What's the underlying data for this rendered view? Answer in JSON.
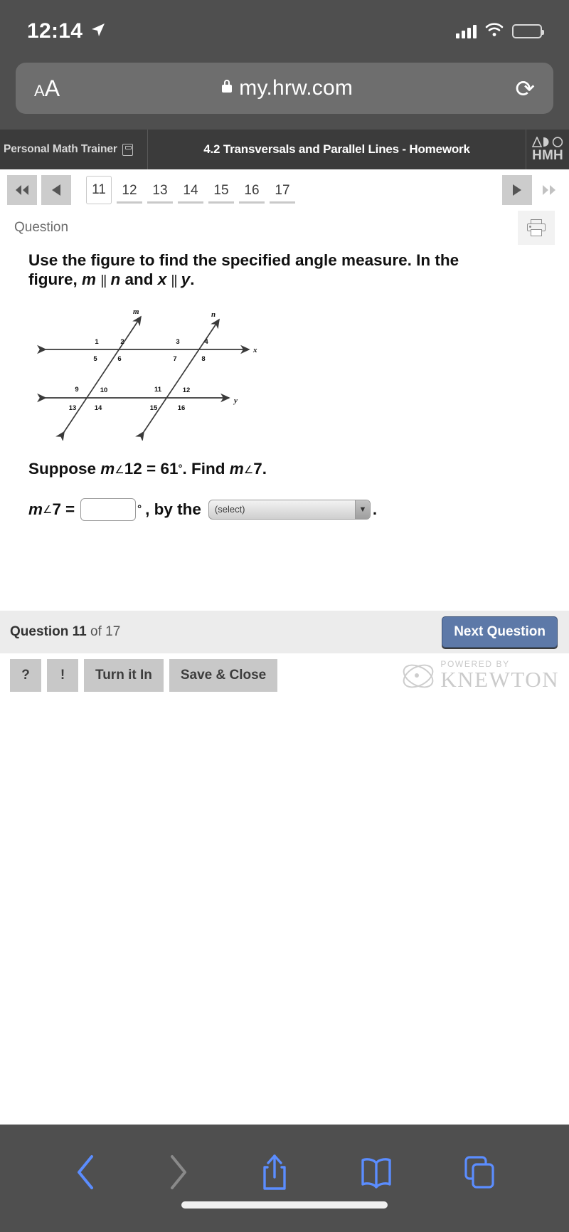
{
  "status_bar": {
    "time": "12:14",
    "location_icon": "location-arrow-icon",
    "signal_icon": "cellular-signal-icon",
    "wifi_icon": "wifi-icon",
    "battery_icon": "battery-low-icon"
  },
  "browser": {
    "text_size_small": "A",
    "text_size_big": "A",
    "lock_icon": "lock-icon",
    "url": "my.hrw.com",
    "reload_icon": "reload-icon",
    "back_icon": "chevron-left-icon",
    "forward_icon": "chevron-right-icon",
    "share_icon": "share-icon",
    "bookmarks_icon": "book-icon",
    "tabs_icon": "tabs-icon"
  },
  "app_header": {
    "brand": "Personal Math Trainer",
    "brand_icon": "cube-icon",
    "title": "4.2 Transversals and Parallel Lines - Homework",
    "logo_text": "HMH",
    "logo_icon": "hmh-logo-icon"
  },
  "pager": {
    "first_icon": "double-left-icon",
    "prev_icon": "left-arrow-icon",
    "next_icon": "right-arrow-icon",
    "last_icon": "double-right-icon",
    "current": "11",
    "pages": [
      "12",
      "13",
      "14",
      "15",
      "16",
      "17"
    ]
  },
  "question_panel": {
    "label": "Question",
    "print_icon": "printer-icon",
    "prompt_line1": "Use the figure to find the specified angle measure. In the",
    "prompt_line2_a": "figure,",
    "prompt_var_m": "m",
    "prompt_par1": "||",
    "prompt_var_n": "n",
    "prompt_and": "and",
    "prompt_var_x": "x",
    "prompt_par2": "||",
    "prompt_var_y": "y",
    "prompt_end": ".",
    "suppose_prefix": "Suppose",
    "suppose_var": "m",
    "suppose_angle_symbol": "∠",
    "suppose_angle_num": "12",
    "suppose_equals": "=",
    "suppose_value": "61",
    "suppose_degree": "°",
    "suppose_find": ". Find",
    "find_var": "m",
    "find_angle_symbol": "∠",
    "find_angle_num": "7",
    "find_period": ".",
    "answer_var": "m",
    "answer_angle_symbol": "∠",
    "answer_angle_num": "7",
    "answer_equals": "=",
    "answer_input_value": "",
    "answer_degree": "°",
    "answer_by_the": ", by the",
    "select_value": "(select)",
    "select_arrow_icon": "chevron-down-icon",
    "answer_period": "."
  },
  "figure": {
    "line_m_label": "m",
    "line_n_label": "n",
    "line_x_label": "x",
    "line_y_label": "y",
    "angle_labels": [
      "1",
      "2",
      "3",
      "4",
      "5",
      "6",
      "7",
      "8",
      "9",
      "10",
      "11",
      "12",
      "13",
      "14",
      "15",
      "16"
    ]
  },
  "footer": {
    "question_word": "Question",
    "question_num": "11",
    "of_word": "of",
    "question_total": "17",
    "next_button": "Next Question",
    "help_button": "?",
    "alert_button": "!",
    "turn_in_button": "Turn it In",
    "save_close_button": "Save & Close",
    "powered_by": "POWERED BY",
    "knewton": "KNEWTON",
    "knewton_icon": "atom-icon"
  },
  "colors": {
    "chrome": "#4f4f4f",
    "header": "#3b3b3b",
    "accent_button": "#5d79a8",
    "ios_blue": "#5b8dff",
    "battery_red": "#f0402f"
  }
}
